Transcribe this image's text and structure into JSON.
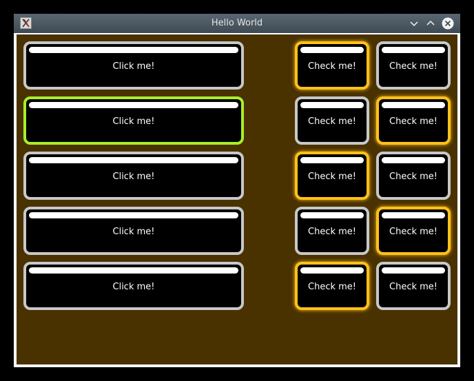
{
  "window": {
    "title": "Hello World",
    "app_icon": "x-window-icon",
    "controls": [
      "minimize-icon",
      "maximize-icon",
      "close-icon"
    ]
  },
  "colors": {
    "background": "#4a3200",
    "button_fill": "#000000",
    "button_border": "#c8c8c8",
    "focus_border": "#a6f02a",
    "checked_border": "#ffc11a"
  },
  "buttons": [
    {
      "label": "Click me!",
      "focused": false
    },
    {
      "label": "Click me!",
      "focused": true
    },
    {
      "label": "Click me!",
      "focused": false
    },
    {
      "label": "Click me!",
      "focused": false
    },
    {
      "label": "Click me!",
      "focused": false
    }
  ],
  "checkboxes": [
    [
      {
        "label": "Check me!",
        "checked": true
      },
      {
        "label": "Check me!",
        "checked": false
      }
    ],
    [
      {
        "label": "Check me!",
        "checked": false
      },
      {
        "label": "Check me!",
        "checked": true
      }
    ],
    [
      {
        "label": "Check me!",
        "checked": true
      },
      {
        "label": "Check me!",
        "checked": false
      }
    ],
    [
      {
        "label": "Check me!",
        "checked": false
      },
      {
        "label": "Check me!",
        "checked": true
      }
    ],
    [
      {
        "label": "Check me!",
        "checked": true
      },
      {
        "label": "Check me!",
        "checked": false
      }
    ]
  ]
}
